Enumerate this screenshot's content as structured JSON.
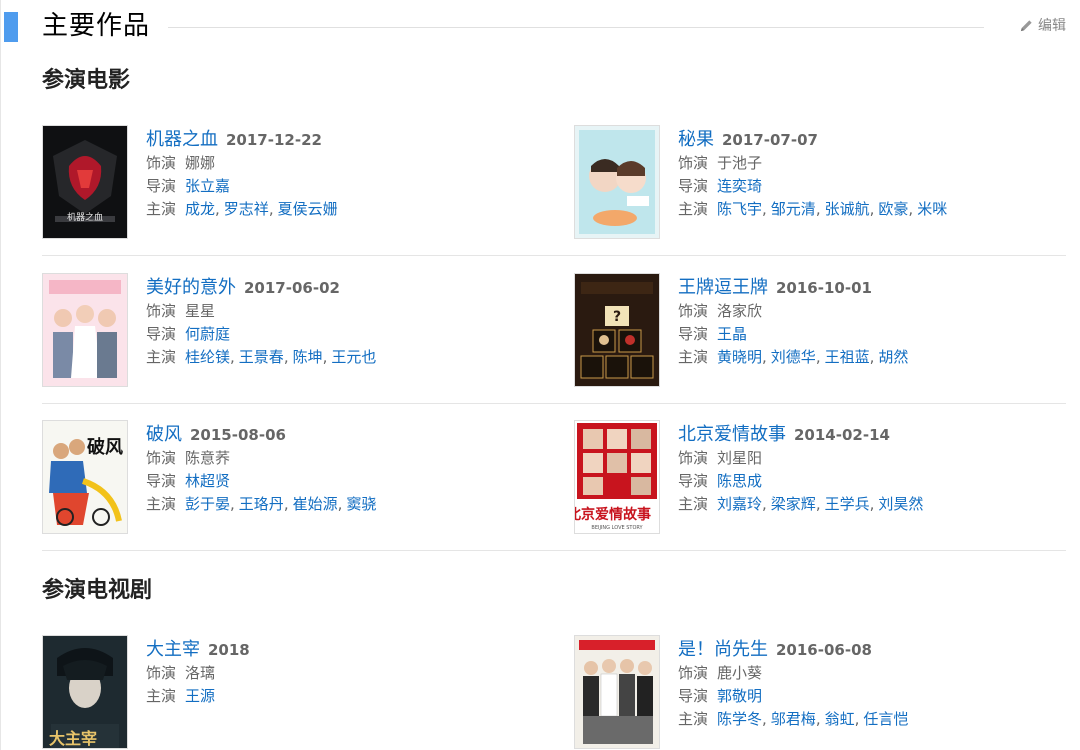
{
  "header": {
    "title": "主要作品",
    "edit_label": "编辑"
  },
  "labels": {
    "role": "饰演",
    "director": "导演",
    "starring": "主演"
  },
  "movies_section": {
    "title": "参演电影",
    "items": [
      {
        "title": "机器之血",
        "date": "2017-12-22",
        "role": "娜娜",
        "director": "张立嘉",
        "stars": [
          "成龙",
          "罗志祥",
          "夏侯云姗"
        ]
      },
      {
        "title": "秘果",
        "date": "2017-07-07",
        "role": "于池子",
        "director": "连奕琦",
        "stars": [
          "陈飞宇",
          "邹元清",
          "张诚航",
          "欧豪",
          "米咪"
        ]
      },
      {
        "title": "美好的意外",
        "date": "2017-06-02",
        "role": "星星",
        "director": "何蔚庭",
        "stars": [
          "桂纶镁",
          "王景春",
          "陈坤",
          "王元也"
        ]
      },
      {
        "title": "王牌逗王牌",
        "date": "2016-10-01",
        "role": "洛家欣",
        "director": "王晶",
        "stars": [
          "黄晓明",
          "刘德华",
          "王祖蓝",
          "胡然"
        ]
      },
      {
        "title": "破风",
        "date": "2015-08-06",
        "role": "陈意荞",
        "director": "林超贤",
        "stars": [
          "彭于晏",
          "王珞丹",
          "崔始源",
          "窦骁"
        ]
      },
      {
        "title": "北京爱情故事",
        "date": "2014-02-14",
        "role": "刘星阳",
        "director": "陈思成",
        "stars": [
          "刘嘉玲",
          "梁家辉",
          "王学兵",
          "刘昊然"
        ]
      }
    ]
  },
  "tv_section": {
    "title": "参演电视剧",
    "items": [
      {
        "title": "大主宰",
        "date": "2018",
        "role": "洛璃",
        "director": "",
        "stars": [
          "王源"
        ]
      },
      {
        "title": "是！尚先生",
        "date": "2016-06-08",
        "role": "鹿小葵",
        "director": "郭敬明",
        "stars": [
          "陈学冬",
          "邬君梅",
          "翁虹",
          "任言恺"
        ]
      }
    ]
  },
  "poster_text": {
    "m0": "机器之血",
    "m4": "破风",
    "m5": "北京爱情故事",
    "m5_en": "BEIJING LOVE STORY",
    "t0": "大主宰"
  },
  "colors": {
    "link": "#136ec2",
    "accent_bar": "#4f9cee"
  }
}
